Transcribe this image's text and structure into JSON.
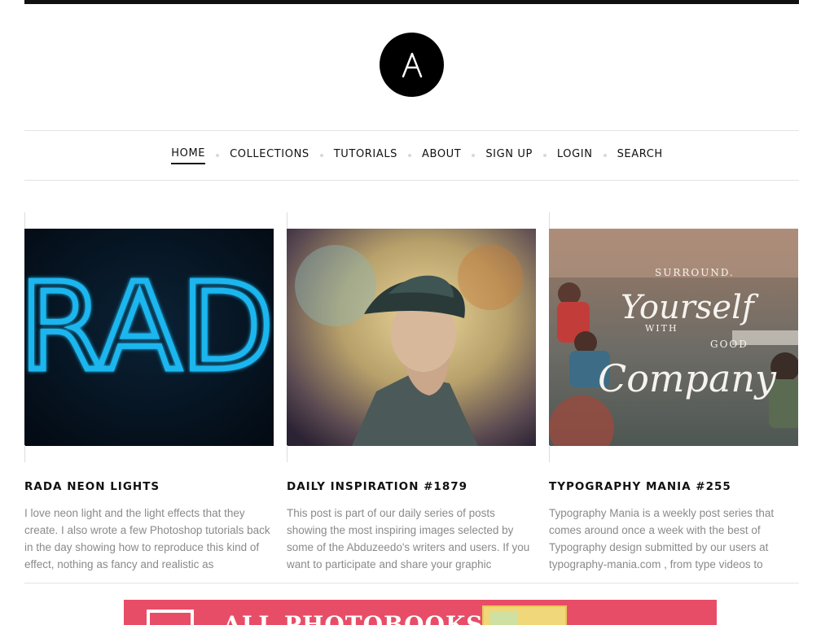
{
  "nav": {
    "items": [
      {
        "label": "HOME",
        "active": true
      },
      {
        "label": "COLLECTIONS",
        "active": false
      },
      {
        "label": "TUTORIALS",
        "active": false
      },
      {
        "label": "ABOUT",
        "active": false
      },
      {
        "label": "SIGN UP",
        "active": false
      },
      {
        "label": "LOGIN",
        "active": false
      },
      {
        "label": "SEARCH",
        "active": false
      }
    ]
  },
  "posts": [
    {
      "title": "RADA NEON LIGHTS",
      "excerpt": "I love neon light and the light effects that they create. I also wrote a few Photoshop tutorials back in the day showing how to reproduce this kind of effect, nothing as fancy and realistic as",
      "image_text": "RADI"
    },
    {
      "title": "DAILY INSPIRATION #1879",
      "excerpt": "This post is part of our daily series of posts showing the most inspiring images selected by some of the Abduzeedo's writers and users. If you want to participate and share your graphic"
    },
    {
      "title": "TYPOGRAPHY MANIA #255",
      "excerpt": "Typography Mania is a weekly post series that comes around once a week with the best of Typography design submitted by our users at typography-mania.com , from type videos to",
      "image_text": {
        "line1": "SURROUND.",
        "line2": "Yourself",
        "line3": "WITH",
        "line4": "GOOD",
        "line5": "Company"
      }
    }
  ],
  "banner": {
    "text": "ALL PHOTOBOOKS"
  },
  "colors": {
    "neon": "#1fb6ef",
    "banner": "#e84d67",
    "nav_dot": "#d8d8d8",
    "excerpt": "#8a8a8a"
  }
}
